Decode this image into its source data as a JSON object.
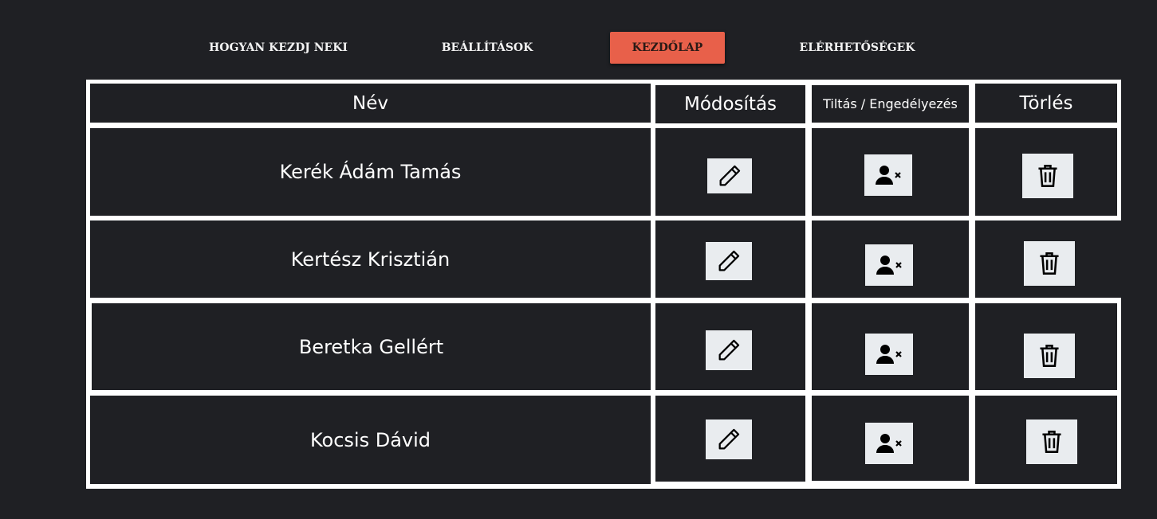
{
  "nav": {
    "items": [
      {
        "label": "HOGYAN KEZDJ NEKI",
        "active": false
      },
      {
        "label": "BEÁLLÍTÁSOK",
        "active": false
      },
      {
        "label": "KEZDŐLAP",
        "active": true
      },
      {
        "label": "ELÉRHETŐSÉGEK",
        "active": false
      }
    ],
    "accent_color": "#e8604a"
  },
  "table": {
    "headers": {
      "name": "Név",
      "edit": "Módosítás",
      "ban": "Tiltás / Engedélyezés",
      "delete": "Törlés"
    },
    "rows": [
      {
        "name": "Kerék Ádám Tamás",
        "edit_icon": "pencil-icon",
        "ban_icon": "user-remove-icon",
        "delete_icon": "trash-icon"
      },
      {
        "name": "Kertész Krisztián",
        "edit_icon": "pencil-icon",
        "ban_icon": "user-remove-icon",
        "delete_icon": "trash-icon"
      },
      {
        "name": "Beretka Gellért",
        "edit_icon": "pencil-icon",
        "ban_icon": "user-remove-icon",
        "delete_icon": "trash-icon"
      },
      {
        "name": "Kocsis Dávid",
        "edit_icon": "pencil-icon",
        "ban_icon": "user-remove-icon",
        "delete_icon": "trash-icon"
      }
    ]
  },
  "colors": {
    "background": "#1f2024",
    "grid_lines": "#ffffff",
    "button_bg": "#e9ecef"
  }
}
